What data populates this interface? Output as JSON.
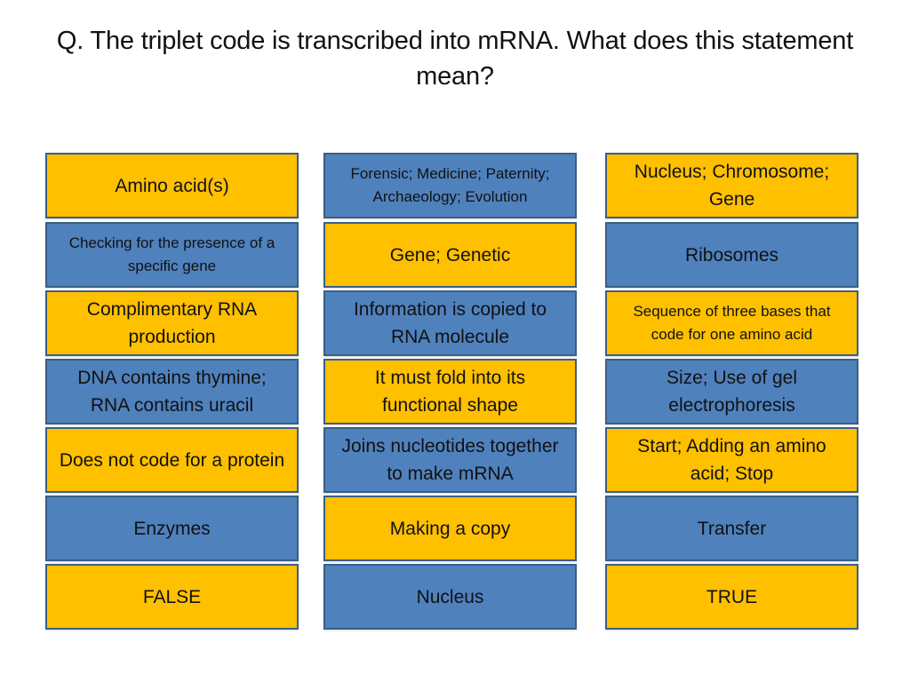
{
  "slide": {
    "title": "Q. The triplet code is transcribed into mRNA. What does this statement mean?",
    "colors": {
      "yellow": "#ffc000",
      "blue": "#4f81bd",
      "border": "#3a5f86"
    },
    "columns": [
      {
        "cards": [
          {
            "label": "Amino acid(s)",
            "color": "yellow"
          },
          {
            "label": "Checking for the presence of a specific gene",
            "color": "blue"
          },
          {
            "label": "Complimentary RNA production",
            "color": "yellow"
          },
          {
            "label": "DNA contains thymine; RNA contains uracil",
            "color": "blue"
          },
          {
            "label": "Does not code for a protein",
            "color": "yellow"
          },
          {
            "label": "Enzymes",
            "color": "blue"
          },
          {
            "label": "FALSE",
            "color": "yellow"
          }
        ]
      },
      {
        "cards": [
          {
            "label": "Forensic; Medicine; Paternity; Archaeology; Evolution",
            "color": "blue"
          },
          {
            "label": "Gene; Genetic",
            "color": "yellow"
          },
          {
            "label": "Information is copied to RNA molecule",
            "color": "blue"
          },
          {
            "label": "It must fold into its functional shape",
            "color": "yellow"
          },
          {
            "label": "Joins nucleotides together to make mRNA",
            "color": "blue"
          },
          {
            "label": "Making a copy",
            "color": "yellow"
          },
          {
            "label": "Nucleus",
            "color": "blue"
          }
        ]
      },
      {
        "cards": [
          {
            "label": "Nucleus; Chromosome; Gene",
            "color": "yellow"
          },
          {
            "label": "Ribosomes",
            "color": "blue"
          },
          {
            "label": "Sequence of three bases that code for one amino acid",
            "color": "yellow"
          },
          {
            "label": "Size; Use of gel electrophoresis",
            "color": "blue"
          },
          {
            "label": "Start; Adding an amino acid; Stop",
            "color": "yellow"
          },
          {
            "label": "Transfer",
            "color": "blue"
          },
          {
            "label": "TRUE",
            "color": "yellow"
          }
        ]
      }
    ]
  }
}
